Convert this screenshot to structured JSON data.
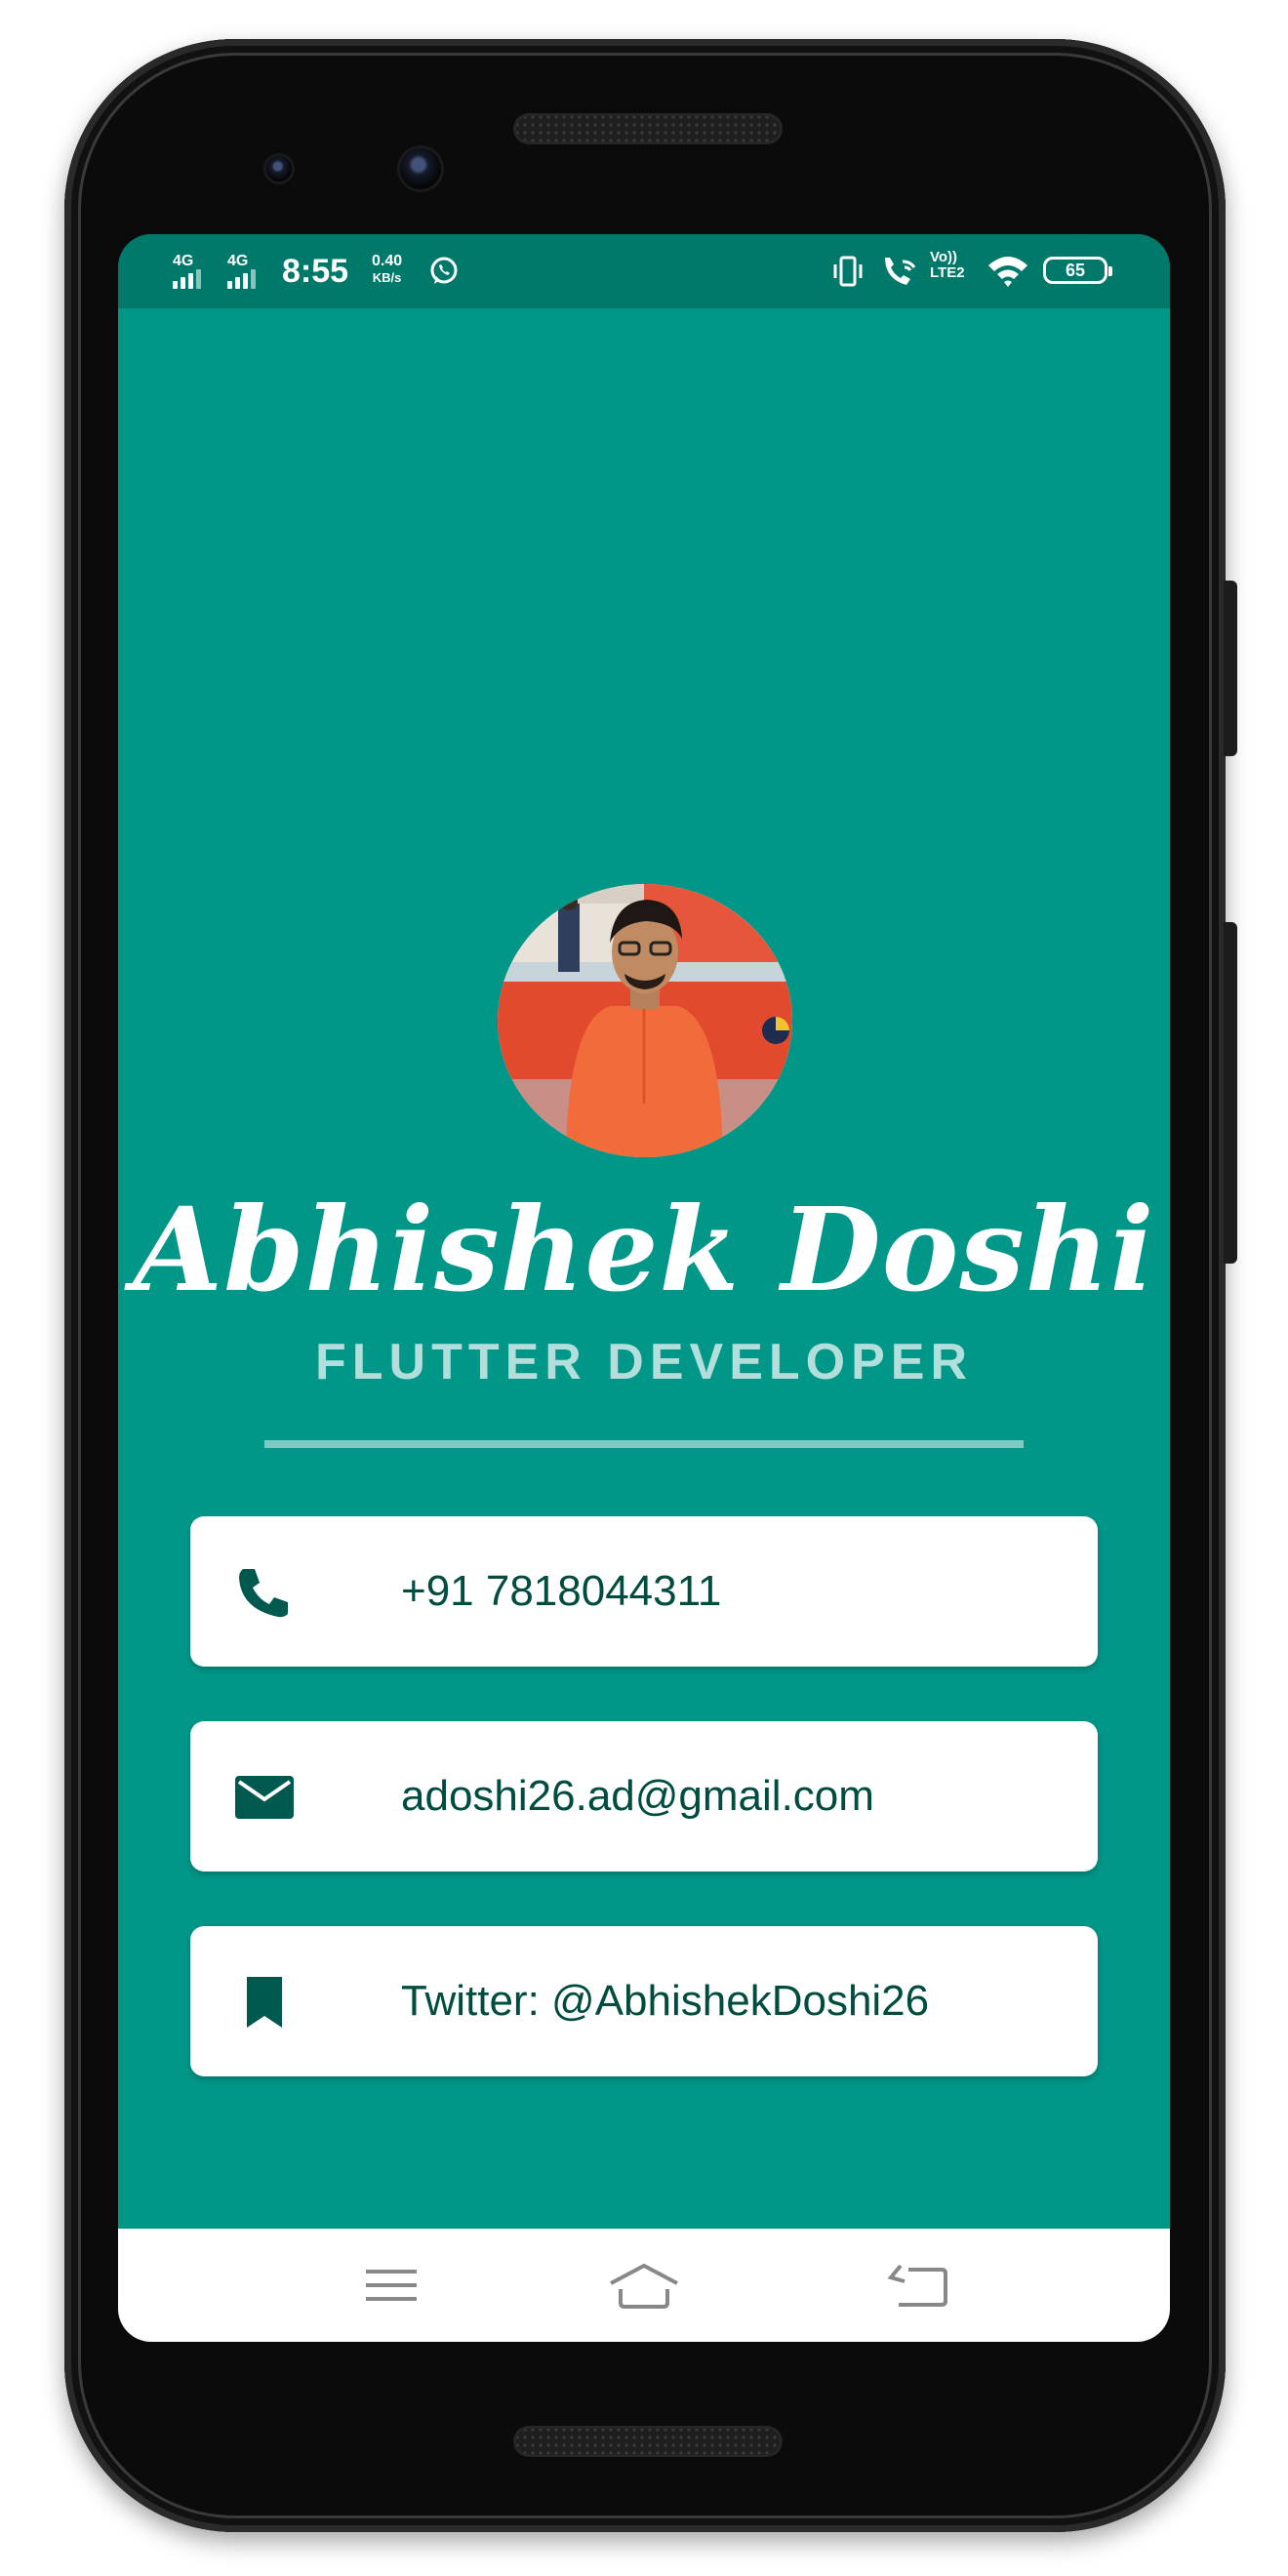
{
  "statusbar": {
    "sim1": "4G",
    "sim2": "4G",
    "time": "8:55",
    "speed_value": "0.40",
    "speed_unit": "KB/s",
    "volte": "Vo))",
    "lte": "LTE2",
    "battery": "65"
  },
  "profile": {
    "name": "Abhishek Doshi",
    "role": "FLUTTER DEVELOPER",
    "avatar_icon": "profile-photo"
  },
  "contacts": [
    {
      "icon": "phone-icon",
      "text": "+91 7818044311"
    },
    {
      "icon": "mail-icon",
      "text": "adoshi26.ad@gmail.com"
    },
    {
      "icon": "bookmark-icon",
      "text": "Twitter: @AbhishekDoshi26"
    }
  ],
  "navbar": {
    "buttons": [
      "menu-icon",
      "home-icon",
      "back-icon"
    ]
  },
  "colors": {
    "background": "#009688",
    "statusbar": "#00796b",
    "role_text": "#b2dfdb",
    "divider": "#80cbc4",
    "card_text": "#004d40",
    "card_icon": "#00594f"
  }
}
